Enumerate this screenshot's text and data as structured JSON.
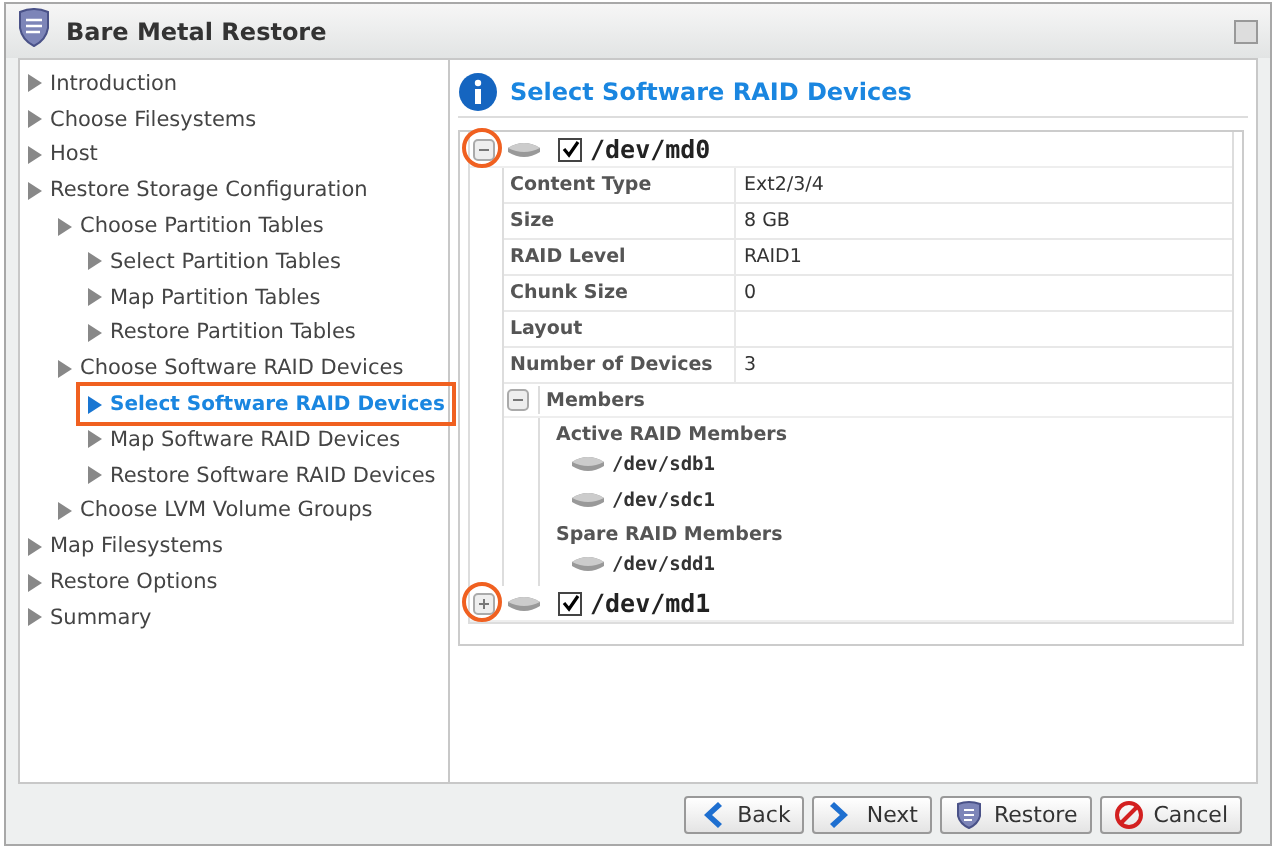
{
  "window": {
    "title": "Bare Metal Restore"
  },
  "nav": [
    {
      "label": "Introduction",
      "selected": false
    },
    {
      "label": "Choose Filesystems",
      "selected": false
    },
    {
      "label": "Host",
      "selected": false
    },
    {
      "label": "Restore Storage Configuration",
      "selected": false,
      "children": [
        {
          "label": "Choose Partition Tables",
          "selected": false,
          "children": [
            {
              "label": "Select Partition Tables",
              "selected": false
            },
            {
              "label": "Map Partition Tables",
              "selected": false
            },
            {
              "label": "Restore Partition Tables",
              "selected": false
            }
          ]
        },
        {
          "label": "Choose Software RAID Devices",
          "selected": false,
          "children": [
            {
              "label": "Select Software RAID Devices",
              "selected": true
            },
            {
              "label": "Map Software RAID Devices",
              "selected": false
            },
            {
              "label": "Restore Software RAID Devices",
              "selected": false
            }
          ]
        },
        {
          "label": "Choose LVM Volume Groups",
          "selected": false
        }
      ]
    },
    {
      "label": "Map Filesystems",
      "selected": false
    },
    {
      "label": "Restore Options",
      "selected": false
    },
    {
      "label": "Summary",
      "selected": false
    }
  ],
  "page_title": "Select Software RAID Devices",
  "devices": [
    {
      "name": "/dev/md0",
      "checked": true,
      "expanded": true,
      "highlighted": true,
      "properties": [
        {
          "label": "Content Type",
          "value": "Ext2/3/4"
        },
        {
          "label": "Size",
          "value": "8 GB"
        },
        {
          "label": "RAID Level",
          "value": "RAID1"
        },
        {
          "label": "Chunk Size",
          "value": "0"
        },
        {
          "label": "Layout"
        },
        {
          "label": "Number of Devices",
          "value": "3"
        }
      ],
      "members": {
        "title": "Members",
        "expanded": true,
        "groups": [
          {
            "title": "Active RAID Members",
            "disks": [
              "/dev/sdb1",
              "/dev/sdc1"
            ]
          },
          {
            "title": "Spare RAID Members",
            "disks": [
              "/dev/sdd1"
            ]
          }
        ]
      }
    },
    {
      "name": "/dev/md1",
      "checked": true,
      "expanded": false,
      "highlighted": true
    }
  ],
  "buttons": [
    {
      "label": "Back",
      "kind": "back"
    },
    {
      "label": "Next",
      "kind": "next"
    },
    {
      "label": "Restore",
      "kind": "restore"
    },
    {
      "label": "Cancel",
      "kind": "cancel"
    }
  ]
}
